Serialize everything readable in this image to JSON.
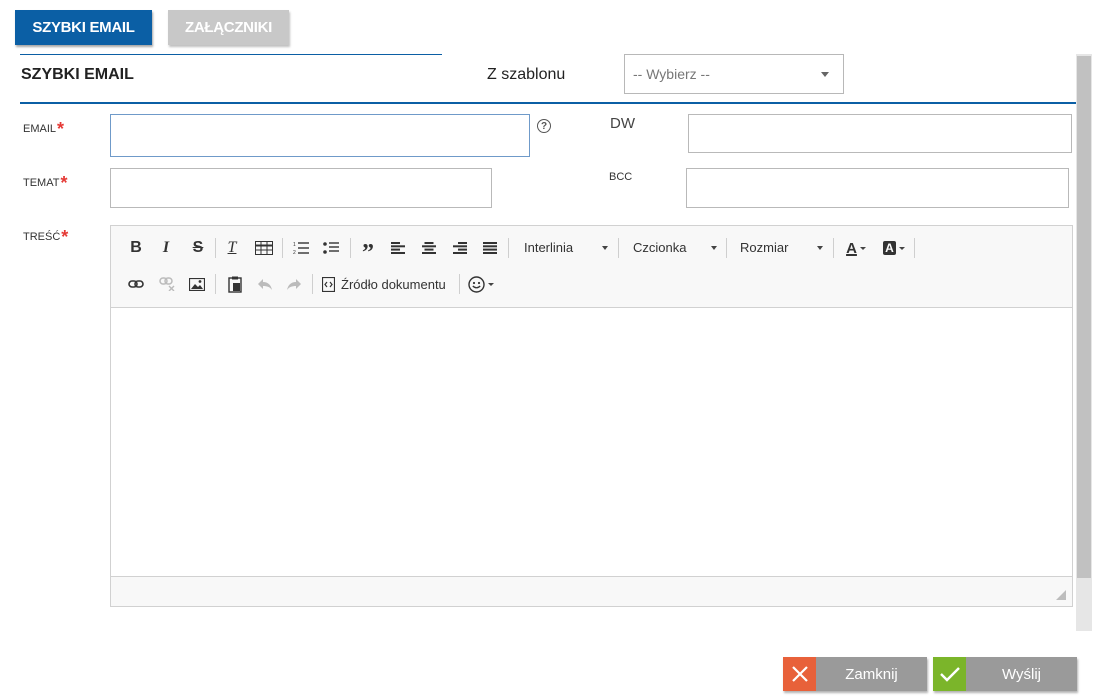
{
  "tabs": [
    {
      "label": "SZYBKI EMAIL",
      "active": true
    },
    {
      "label": "ZAŁĄCZNIKI",
      "active": false
    }
  ],
  "section_title": "SZYBKI EMAIL",
  "template": {
    "label": "Z szablonu",
    "selected": "-- Wybierz --"
  },
  "fields": {
    "email": {
      "label": "EMAIL",
      "value": ""
    },
    "cc": {
      "label": "DW",
      "value": ""
    },
    "subject": {
      "label": "TEMAT",
      "value": ""
    },
    "bcc": {
      "label": "BCC",
      "value": ""
    },
    "body": {
      "label": "TREŚĆ",
      "value": ""
    }
  },
  "required_mark": "*",
  "help_mark": "?",
  "toolbar": {
    "bold": "B",
    "italic": "I",
    "strike": "S",
    "clear_format": "T",
    "line_height": "Interlinia",
    "font": "Czcionka",
    "size": "Rozmiar",
    "text_color": "A",
    "bg_color": "A",
    "quote": "”",
    "source": "Źródło dokumentu"
  },
  "buttons": {
    "close": "Zamknij",
    "send": "Wyślij"
  },
  "colors": {
    "accent": "#0b5fa5",
    "required": "#e53935",
    "close_icon_bg": "#e8613a",
    "send_icon_bg": "#7bb52a",
    "button_bg": "#9a9a9a"
  }
}
